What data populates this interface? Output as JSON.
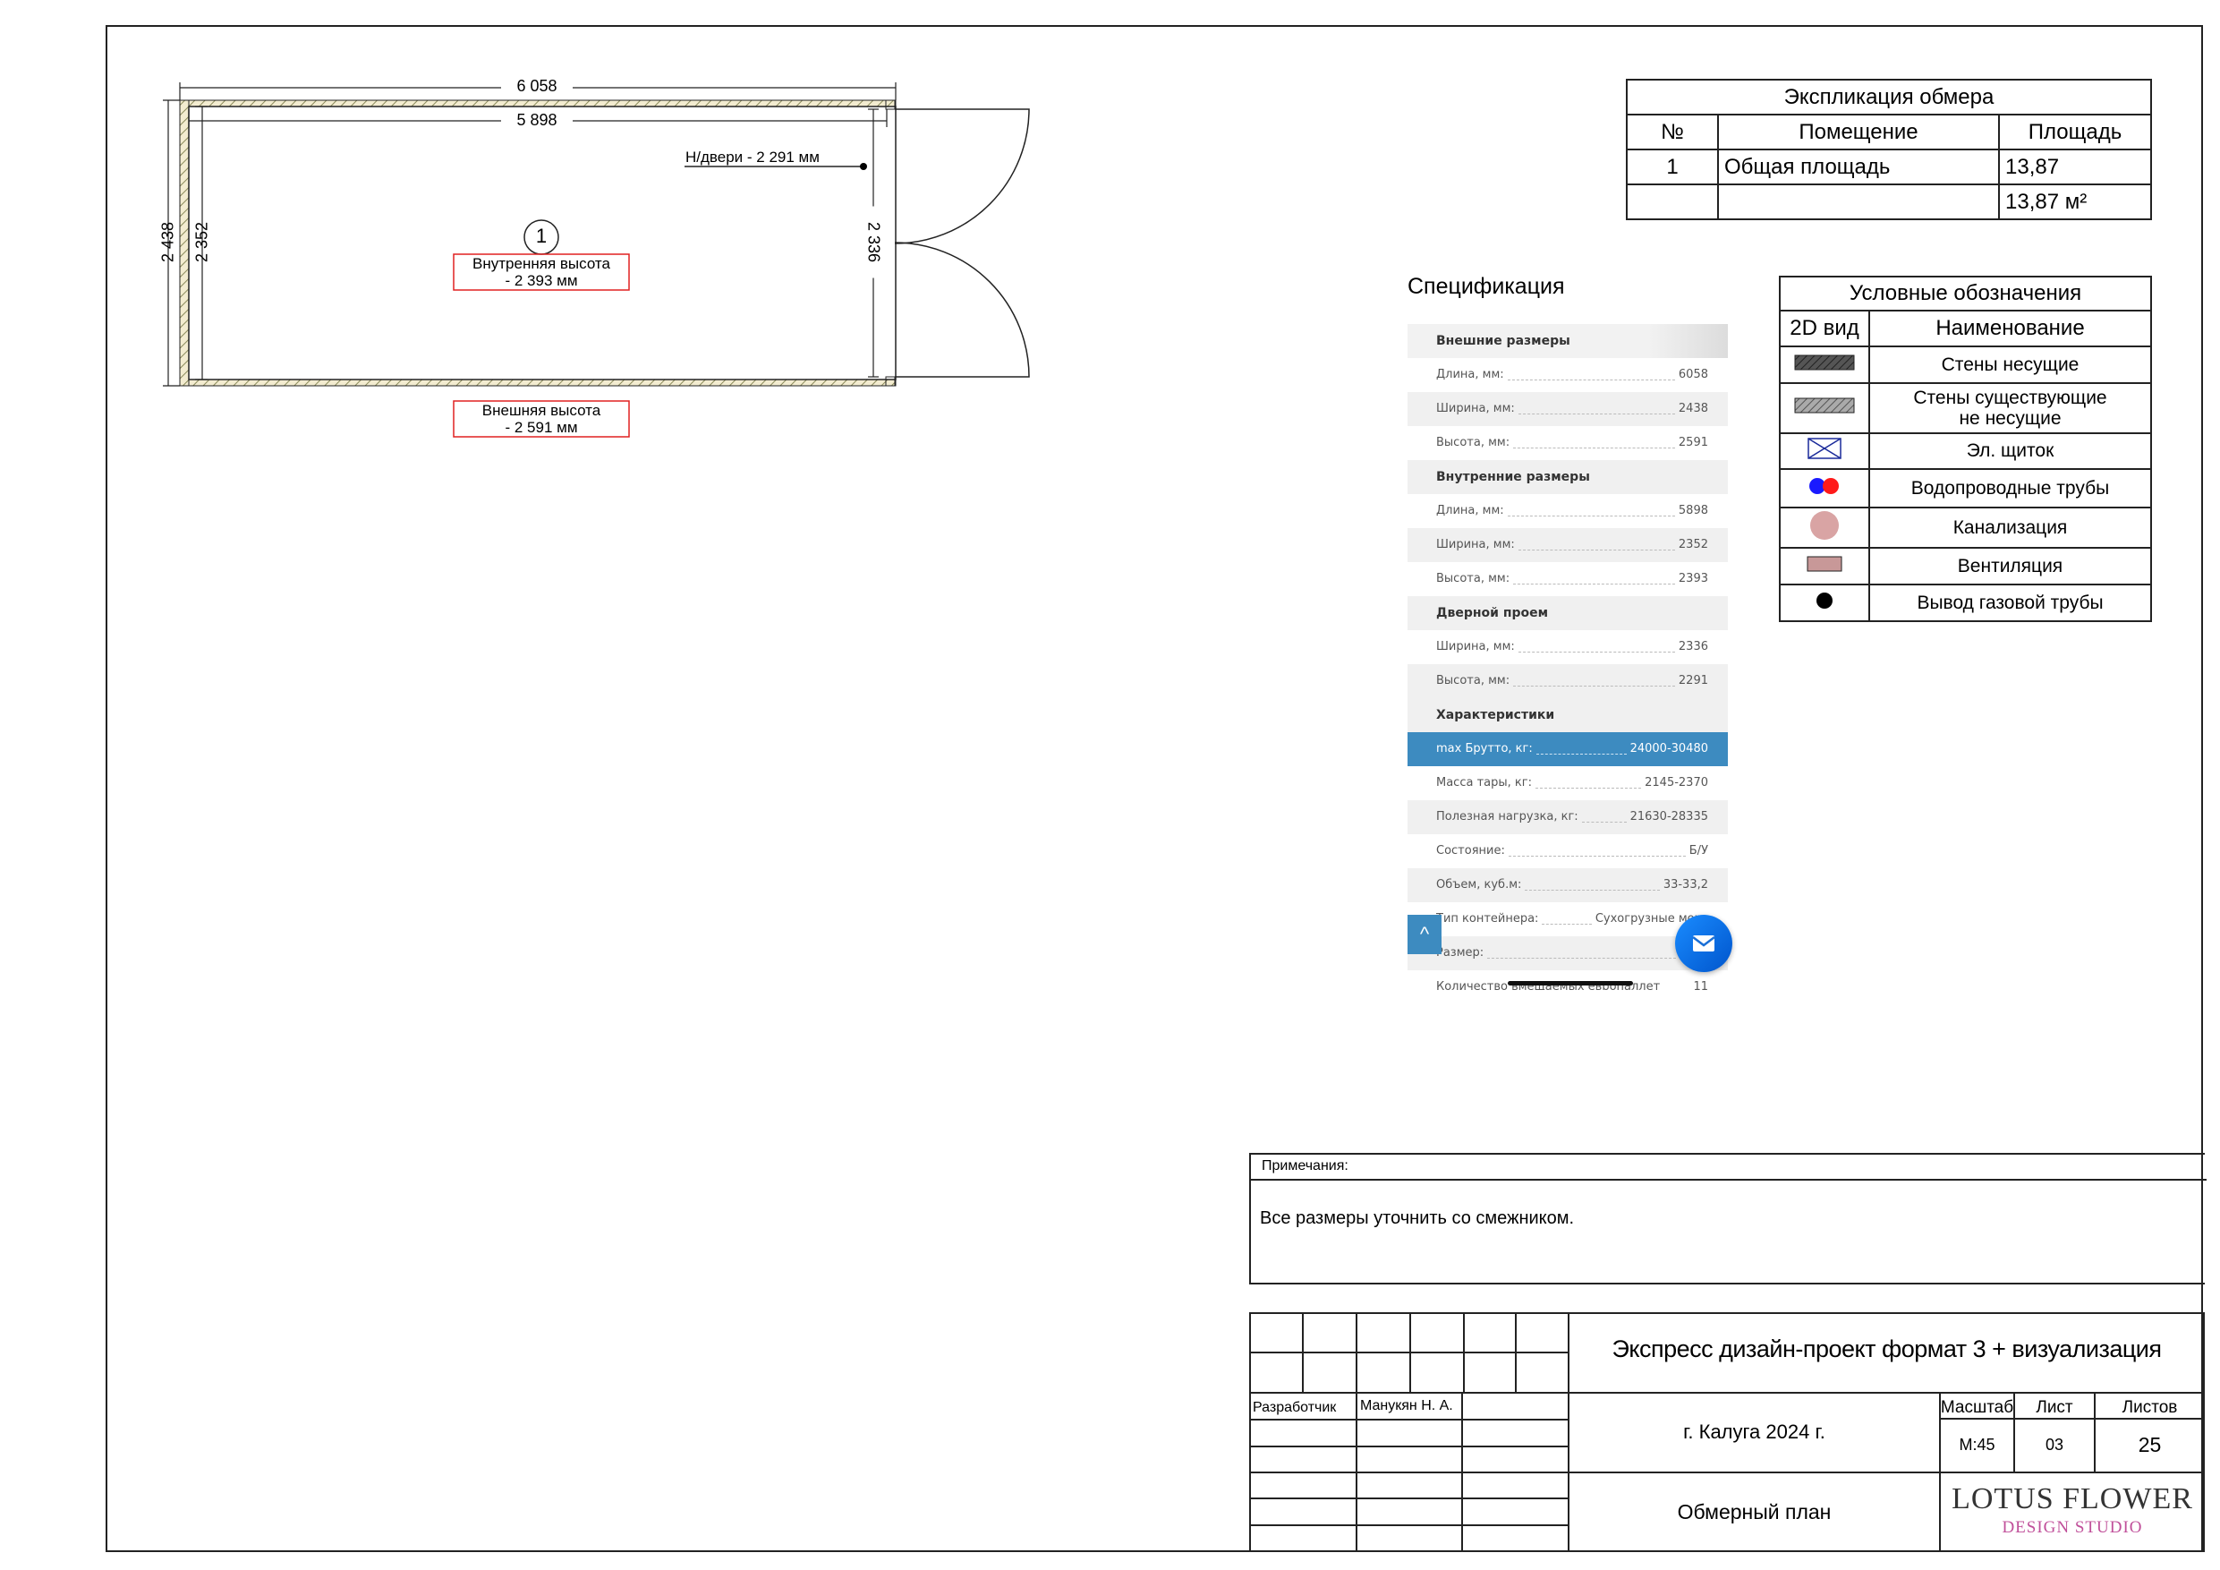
{
  "plan": {
    "dim_outer_length": "6 058",
    "dim_inner_length": "5 898",
    "dim_outer_width": "2 438",
    "dim_inner_width": "2 352",
    "dim_door": "2 336",
    "door_height_label": "Н/двери - 2 291 мм",
    "room_number": "1",
    "inner_height": [
      "Внутренняя высота",
      "- 2 393 мм"
    ],
    "outer_height": [
      "Внешняя высота",
      "- 2 591 мм"
    ]
  },
  "explication": {
    "title": "Экспликация обмера",
    "headers": [
      "№",
      "Помещение",
      "Площадь"
    ],
    "rows": [
      [
        "1",
        "Общая площадь",
        "13,87"
      ]
    ],
    "total": "13,87 м²"
  },
  "legend": {
    "title": "Условные обозначения",
    "headers": [
      "2D вид",
      "Наименование"
    ],
    "items": [
      {
        "icon": "bearing-wall-icon",
        "name": "Стены несущие"
      },
      {
        "icon": "non-bearing-wall-icon",
        "name": "Стены существующие\nне несущие"
      },
      {
        "icon": "electrical-panel-icon",
        "name": "Эл. щиток"
      },
      {
        "icon": "water-pipes-icon",
        "name": "Водопроводные трубы"
      },
      {
        "icon": "sewerage-icon",
        "name": "Канализация"
      },
      {
        "icon": "ventilation-icon",
        "name": "Вентиляция"
      },
      {
        "icon": "gas-pipe-icon",
        "name": "Вывод газовой трубы"
      }
    ],
    "colors": {
      "wall_dark": "#555555",
      "wall_light": "#999999",
      "panel": "#1a2a9a",
      "water_blue": "#1a1aff",
      "water_red": "#ff1a1a",
      "sewer": "#d9a4a4",
      "vent": "#c89898"
    }
  },
  "specification": {
    "title": "Спецификация",
    "rows": [
      {
        "type": "head",
        "label": "Внешние размеры"
      },
      {
        "type": "row",
        "label": "Длина, мм:",
        "value": "6058"
      },
      {
        "type": "row",
        "label": "Ширина, мм:",
        "value": "2438"
      },
      {
        "type": "row",
        "label": "Высота, мм:",
        "value": "2591"
      },
      {
        "type": "head",
        "label": "Внутренние размеры"
      },
      {
        "type": "row",
        "label": "Длина, мм:",
        "value": "5898"
      },
      {
        "type": "row",
        "label": "Ширина, мм:",
        "value": "2352"
      },
      {
        "type": "row",
        "label": "Высота, мм:",
        "value": "2393"
      },
      {
        "type": "head",
        "label": "Дверной проем"
      },
      {
        "type": "row",
        "label": "Ширина, мм:",
        "value": "2336"
      },
      {
        "type": "row",
        "label": "Высота, мм:",
        "value": "2291"
      },
      {
        "type": "head",
        "label": "Характеристики"
      },
      {
        "type": "hl",
        "label": "max Брутто, кг:",
        "value": "24000-30480"
      },
      {
        "type": "row",
        "label": "Масса тары, кг:",
        "value": "2145-2370"
      },
      {
        "type": "row",
        "label": "Полезная нагрузка, кг:",
        "value": "21630-28335"
      },
      {
        "type": "row",
        "label": "Состояние:",
        "value": "Б/У"
      },
      {
        "type": "row",
        "label": "Объем, куб.м:",
        "value": "33-33,2"
      },
      {
        "type": "row",
        "label": "Тип контейнера:",
        "value": "Сухогрузные морс"
      },
      {
        "type": "row",
        "label": "Размер:",
        "value": "20 ф"
      },
      {
        "type": "row",
        "label": "Количество вмещаемых европаллет",
        "value": "11"
      }
    ]
  },
  "notes": {
    "header": "Примечания:",
    "text": "Все размеры уточнить со смежником."
  },
  "stamp": {
    "project": "Экспресс дизайн-проект формат 3 + визуализация",
    "city": "г. Калуга 2024 г.",
    "sheet_title": "Обмерный план",
    "developer_label": "Разработчик",
    "developer_name": "Манукян Н. А.",
    "scale_label": "Масштаб",
    "sheet_label": "Лист",
    "sheets_label": "Листов",
    "scale": "М:45",
    "sheet": "03",
    "sheets": "25",
    "logo_top": "LOTUS FLOWER",
    "logo_bottom": "DESIGN STUDIO",
    "logo_color": "#c0509a"
  }
}
